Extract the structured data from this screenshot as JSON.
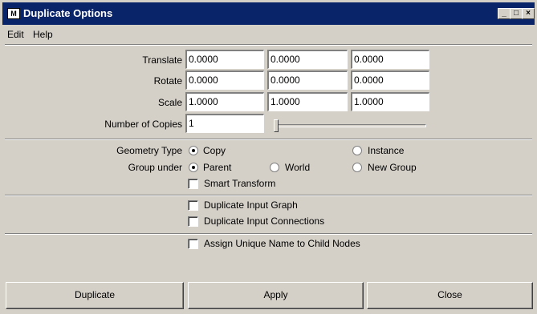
{
  "window": {
    "title": "Duplicate Options",
    "icon_label": "M",
    "minimize_symbol": "_",
    "maximize_symbol": "□",
    "close_symbol": "×"
  },
  "menubar": {
    "items": [
      {
        "label": "Edit"
      },
      {
        "label": "Help"
      }
    ]
  },
  "transform": {
    "translate": {
      "label": "Translate",
      "values": [
        "0.0000",
        "0.0000",
        "0.0000"
      ]
    },
    "rotate": {
      "label": "Rotate",
      "values": [
        "0.0000",
        "0.0000",
        "0.0000"
      ]
    },
    "scale": {
      "label": "Scale",
      "values": [
        "1.0000",
        "1.0000",
        "1.0000"
      ]
    },
    "copies": {
      "label": "Number of Copies",
      "value": "1",
      "slider_fraction": 0
    }
  },
  "geometry_type": {
    "label": "Geometry Type",
    "options": [
      {
        "label": "Copy",
        "selected": true
      },
      {
        "label": "Instance",
        "selected": false
      }
    ]
  },
  "group_under": {
    "label": "Group under",
    "options": [
      {
        "label": "Parent",
        "selected": true
      },
      {
        "label": "World",
        "selected": false
      },
      {
        "label": "New Group",
        "selected": false
      }
    ]
  },
  "checkboxes": {
    "smart_transform": {
      "label": "Smart Transform",
      "checked": false
    },
    "duplicate_input_graph": {
      "label": "Duplicate Input Graph",
      "checked": false
    },
    "duplicate_input_connections": {
      "label": "Duplicate Input Connections",
      "checked": false
    },
    "assign_unique_name": {
      "label": "Assign Unique Name to Child Nodes",
      "checked": false
    }
  },
  "buttons": {
    "duplicate": "Duplicate",
    "apply": "Apply",
    "close": "Close"
  },
  "colors": {
    "title_bar": "#0a246a",
    "face": "#d4d0c8",
    "field": "#ffffff"
  }
}
